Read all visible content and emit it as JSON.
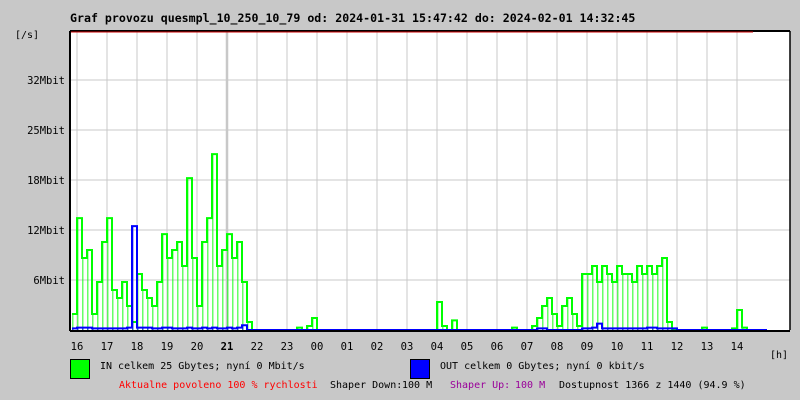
{
  "title": "Graf provozu quesmpl_10_250_10_79 od: 2024-01-31 15:47:42 do: 2024-02-01 14:32:45",
  "y_unit": "[/s]",
  "x_unit": "[h]",
  "colors": {
    "in": "#00ff00",
    "out": "#0000ff",
    "grid": "#c8c8c8",
    "top_line": "#cc0000",
    "red_text": "#ff0000",
    "purple_text": "#990099"
  },
  "legend": {
    "in": "IN celkem 25 Gbytes; nyní 0 Mbit/s",
    "out": "OUT celkem 0 Gbytes; nyní 0 kbit/s"
  },
  "footer": {
    "allowed": "Aktualne povoleno 100 % rychlosti",
    "shaper_down_label": "Shaper Down:",
    "shaper_down_value": "100 M",
    "shaper_up_label": "Shaper Up:",
    "shaper_up_value": "100 M",
    "availability": "Dostupnost 1366 z 1440 (94.9 %)"
  },
  "chart_data": {
    "type": "bar",
    "title": "Graf provozu quesmpl_10_250_10_79 od: 2024-01-31 15:47:42 do: 2024-02-01 14:32:45",
    "xlabel": "[h]",
    "ylabel": "[/s]",
    "ylim": [
      0,
      37.4
    ],
    "y_ticks": [
      {
        "value": 6.25,
        "label": "6Mbit"
      },
      {
        "value": 12.5,
        "label": "12Mbit"
      },
      {
        "value": 18.75,
        "label": "18Mbit"
      },
      {
        "value": 25,
        "label": "25Mbit"
      },
      {
        "value": 31.25,
        "label": "32Mbit"
      }
    ],
    "x_ticks": [
      "16",
      "17",
      "18",
      "19",
      "20",
      "21",
      "22",
      "23",
      "00",
      "01",
      "02",
      "03",
      "04",
      "05",
      "06",
      "07",
      "08",
      "09",
      "10",
      "11",
      "12",
      "13",
      "14"
    ],
    "x_bold_tick": "21",
    "sample_start": "15:50",
    "sample_interval_min": 10,
    "series": [
      {
        "name": "IN",
        "unit": "Mbit/s",
        "values": [
          2,
          14,
          9,
          10,
          2,
          6,
          11,
          14,
          5,
          4,
          6,
          3,
          1,
          7,
          5,
          4,
          3,
          6,
          12,
          9,
          10,
          11,
          8,
          19,
          9,
          3,
          11,
          14,
          22,
          8,
          10,
          12,
          9,
          11,
          6,
          1,
          0,
          0,
          0,
          0,
          0,
          0,
          0,
          0,
          0,
          0.3,
          0,
          0.5,
          1.5,
          0,
          0,
          0,
          0,
          0,
          0,
          0,
          0,
          0,
          0,
          0,
          0,
          0,
          0,
          0,
          0,
          0,
          0,
          0,
          0,
          0,
          0,
          0,
          0,
          3.5,
          0.5,
          0,
          1.2,
          0,
          0,
          0,
          0,
          0,
          0,
          0,
          0,
          0,
          0,
          0,
          0.3,
          0,
          0,
          0,
          0.5,
          1.5,
          3,
          4,
          2,
          0.5,
          3,
          4,
          2,
          0.5,
          7,
          7,
          8,
          6,
          8,
          7,
          6,
          8,
          7,
          7,
          6,
          8,
          7,
          8,
          7,
          8,
          9,
          1,
          0,
          0,
          0,
          0,
          0,
          0,
          0.3,
          0,
          0,
          0,
          0,
          0,
          0.2,
          2.5,
          0.3,
          0
        ]
      },
      {
        "name": "OUT",
        "unit": "Mbit/s",
        "values": [
          0.2,
          0.3,
          0.3,
          0.3,
          0.2,
          0.2,
          0.2,
          0.2,
          0.2,
          0.2,
          0.2,
          0.3,
          13,
          0.3,
          0.3,
          0.3,
          0.2,
          0.2,
          0.3,
          0.3,
          0.2,
          0.2,
          0.2,
          0.3,
          0.2,
          0.2,
          0.3,
          0.2,
          0.3,
          0.2,
          0.2,
          0.3,
          0.2,
          0.3,
          0.6,
          0,
          0,
          0,
          0,
          0,
          0,
          0,
          0,
          0,
          0,
          0,
          0,
          0,
          0,
          0,
          0,
          0,
          0,
          0,
          0,
          0,
          0,
          0,
          0,
          0,
          0,
          0,
          0,
          0,
          0,
          0,
          0,
          0,
          0,
          0,
          0,
          0,
          0,
          0,
          0,
          0,
          0,
          0,
          0,
          0,
          0,
          0,
          0,
          0,
          0,
          0,
          0,
          0,
          0,
          0,
          0,
          0,
          0,
          0.2,
          0.2,
          0,
          0,
          0,
          0,
          0,
          0,
          0,
          0.2,
          0.2,
          0.3,
          0.8,
          0.2,
          0.2,
          0.2,
          0.2,
          0.2,
          0.2,
          0.2,
          0.2,
          0.2,
          0.3,
          0.3,
          0.2,
          0.2,
          0.2,
          0.2,
          0,
          0,
          0,
          0,
          0,
          0,
          0,
          0,
          0,
          0,
          0,
          0,
          0,
          0,
          0,
          0,
          0,
          0
        ]
      }
    ]
  }
}
